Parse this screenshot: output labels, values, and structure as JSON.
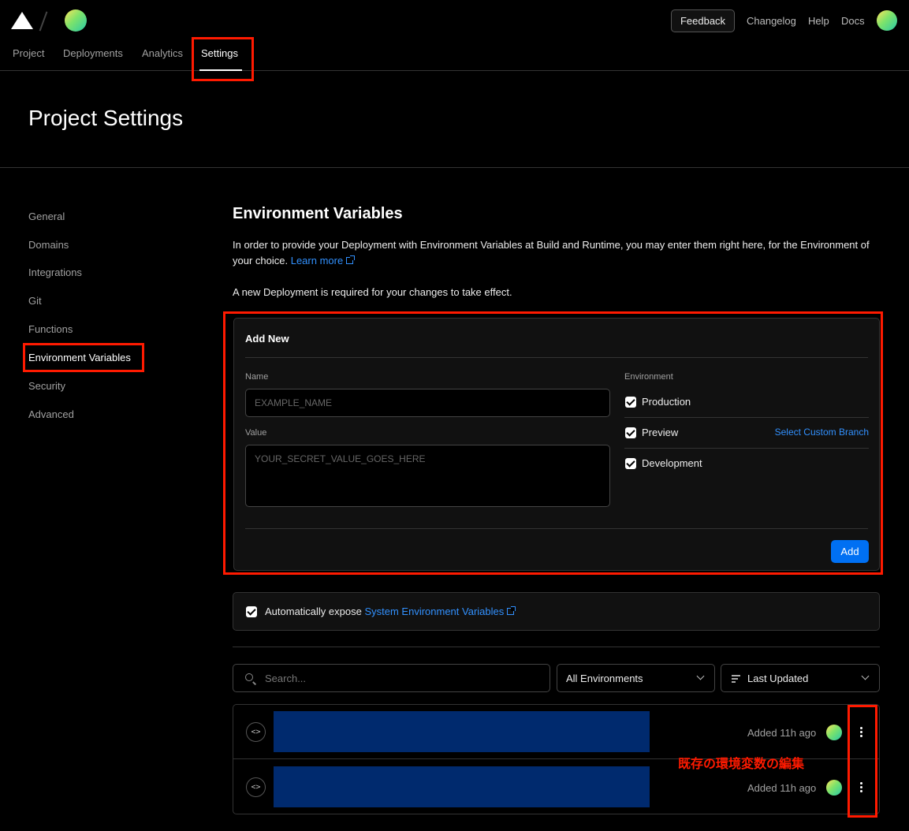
{
  "header": {
    "nav_links": {
      "changelog": "Changelog",
      "help": "Help",
      "docs": "Docs"
    },
    "feedback_label": "Feedback",
    "tabs": [
      "Project",
      "Deployments",
      "Analytics",
      "Settings"
    ],
    "active_tab": "Settings"
  },
  "page": {
    "title": "Project Settings"
  },
  "sidebar": {
    "items": [
      "General",
      "Domains",
      "Integrations",
      "Git",
      "Functions",
      "Environment Variables",
      "Security",
      "Advanced"
    ],
    "active": "Environment Variables"
  },
  "main": {
    "title": "Environment Variables",
    "description": "In order to provide your Deployment with Environment Variables at Build and Runtime, you may enter them right here, for the Environment of your choice.",
    "learn_more": "Learn more",
    "note": "A new Deployment is required for your changes to take effect.",
    "add_new": {
      "title": "Add New",
      "name_label": "Name",
      "name_placeholder": "EXAMPLE_NAME",
      "value_label": "Value",
      "value_placeholder": "YOUR_SECRET_VALUE_GOES_HERE",
      "environment_label": "Environment",
      "environments": [
        {
          "label": "Production",
          "checked": true
        },
        {
          "label": "Preview",
          "checked": true
        },
        {
          "label": "Development",
          "checked": true
        }
      ],
      "custom_branch": "Select Custom Branch",
      "add_button": "Add"
    },
    "auto_expose": {
      "checked": true,
      "prefix": "Automatically expose",
      "link": "System Environment Variables"
    },
    "filters": {
      "search_placeholder": "Search...",
      "environment_select": "All Environments",
      "sort_select": "Last Updated"
    },
    "variables": [
      {
        "added": "Added 11h ago"
      },
      {
        "added": "Added 11h ago"
      }
    ]
  },
  "annotation": {
    "text": "既存の環境変数の編集"
  },
  "colors": {
    "accent": "#0070f3",
    "link": "#3291ff",
    "highlight": "#ff1a00",
    "redacted": "#002a6e"
  }
}
